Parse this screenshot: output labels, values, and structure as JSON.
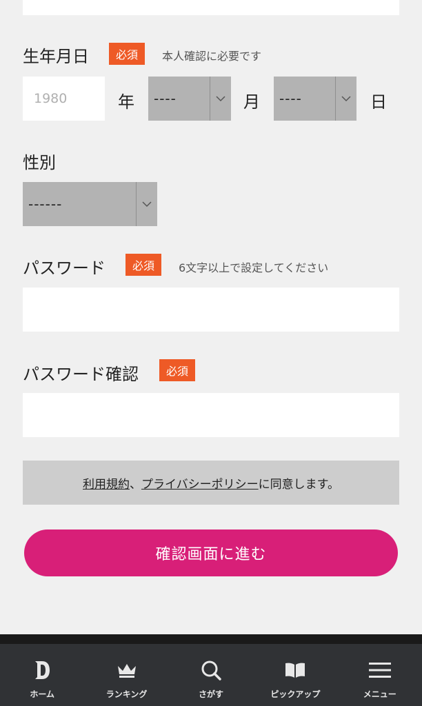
{
  "birthday": {
    "label": "生年月日",
    "required": "必須",
    "hint": "本人確認に必要です",
    "year_placeholder": "1980",
    "year_unit": "年",
    "month_value": "----",
    "month_unit": "月",
    "day_value": "----",
    "day_unit": "日"
  },
  "gender": {
    "label": "性別",
    "value": "------"
  },
  "password": {
    "label": "パスワード",
    "required": "必須",
    "hint": "6文字以上で設定してください",
    "value": ""
  },
  "password_confirm": {
    "label": "パスワード確認",
    "required": "必須",
    "value": ""
  },
  "agreement": {
    "terms_link": "利用規約",
    "separator": "、",
    "privacy_link": "プライバシーポリシー",
    "suffix": "に同意します。"
  },
  "submit_label": "確認画面に進む",
  "tabbar": {
    "items": [
      {
        "label": "ホーム",
        "icon": "home-d-logo-icon"
      },
      {
        "label": "ランキング",
        "icon": "crown-icon"
      },
      {
        "label": "さがす",
        "icon": "search-icon"
      },
      {
        "label": "ピックアップ",
        "icon": "book-icon"
      },
      {
        "label": "メニュー",
        "icon": "hamburger-menu-icon"
      }
    ]
  },
  "colors": {
    "background": "#f0f0f0",
    "required_badge": "#ee5a26",
    "select_bg": "#b3b3b3",
    "submit_bg": "#d81f78",
    "tabbar_bg": "#303235"
  }
}
